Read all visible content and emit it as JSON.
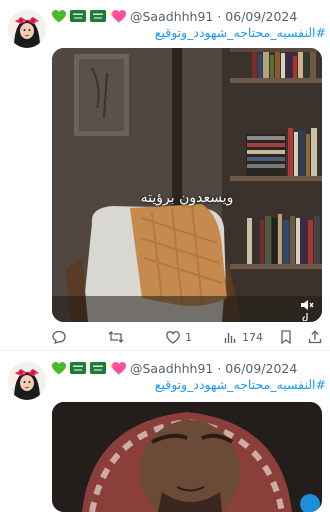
{
  "posts": [
    {
      "header": {
        "emojis": [
          "green-heart",
          "saudi-flag",
          "saudi-flag",
          "sparkling-heart"
        ],
        "handle_date": "@Saadhhh91 · 06/09/2024"
      },
      "hashtag": "#النفسيه_محتاجه_شهودد_وتوقيع",
      "video_caption": "ويسعدون برؤيته",
      "actions": {
        "reply_count": "",
        "repost_count": "",
        "like_count": "1",
        "views_count": "174"
      }
    },
    {
      "header": {
        "emojis": [
          "green-heart",
          "saudi-flag",
          "saudi-flag",
          "sparkling-heart"
        ],
        "handle_date": "@Saadhhh91 · 06/09/2024"
      },
      "hashtag": "#النفسيه_محتاجه_شهودد_وتوقيع"
    }
  ],
  "colors": {
    "link": "#1d9bf0",
    "muted": "#536471",
    "green_heart": "#4cba27",
    "flag_green": "#1e7b3a",
    "sparkle_heart": "#ff4fa0"
  },
  "icons": [
    "reply-icon",
    "repost-icon",
    "like-icon",
    "views-icon",
    "bookmark-icon",
    "share-icon",
    "mute-icon",
    "tiktok-icon"
  ]
}
